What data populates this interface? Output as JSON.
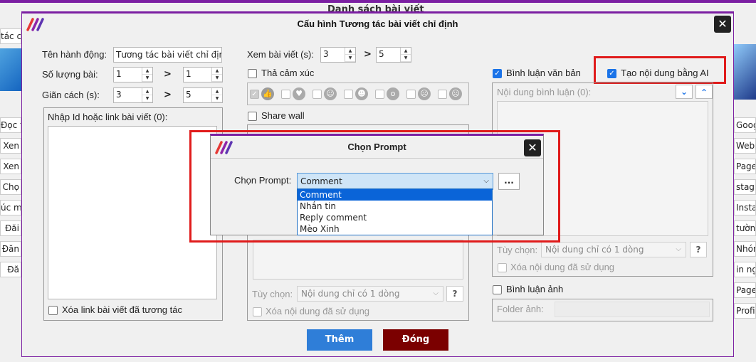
{
  "background": {
    "title": "Danh sách bài viết",
    "left_items": [
      "tác cá",
      "Đọc t",
      "Xen",
      "Xen",
      "Chọ",
      "úc mừ",
      "Đăi",
      "Đăn",
      "Đă"
    ],
    "right_items": [
      "Google",
      "Website",
      "Page",
      "stagram",
      "Instagr",
      "tường",
      "Nhóm",
      "in nghi",
      "Page",
      "Profile"
    ]
  },
  "dialog": {
    "title": "Cấu hình Tương tác bài viết chỉ định",
    "close": "✕",
    "col1": {
      "action_name_label": "Tên hành động:",
      "action_name_value": "Tương tác bài viết chỉ định",
      "post_count_label": "Số lượng bài:",
      "post_count_min": "1",
      "post_count_max": "1",
      "interval_label": "Giãn cách (s):",
      "interval_min": "3",
      "interval_max": "5",
      "gt": ">",
      "link_label": "Nhập Id hoặc link bài viết (0):",
      "delete_link_label": "Xóa link bài viết đã tương tác"
    },
    "col2": {
      "view_label": "Xem bài viết (s):",
      "view_min": "3",
      "view_max": "5",
      "react_label": "Thả cảm xúc",
      "share_label": "Share wall",
      "option_label": "Tùy chọn:",
      "option_value": "Nội dung chỉ có 1 dòng",
      "help": "?",
      "delete_used_label": "Xóa nội dung đã sử dụng"
    },
    "col3": {
      "text_comment_label": "Bình luận văn bản",
      "ai_label": "Tạo nội dung bằng AI",
      "comment_content_label": "Nội dung bình luận (0):",
      "option_label": "Tùy chọn:",
      "option_value": "Nội dung chỉ có 1 dòng",
      "help": "?",
      "delete_used_label": "Xóa nội dung đã sử dụng",
      "image_comment_label": "Bình luận ảnh",
      "folder_label": "Folder ảnh:"
    },
    "add_button": "Thêm",
    "close_button": "Đóng"
  },
  "prompt_dialog": {
    "title": "Chọn Prompt",
    "close": "✕",
    "label": "Chọn Prompt:",
    "selected": "Comment",
    "more": "...",
    "options": [
      "Comment",
      "Nhắn tin",
      "Reply comment",
      "Mèo Xinh"
    ]
  },
  "colors": {
    "accent": "#7b1fa2",
    "primary": "#2f7ed8",
    "danger": "#7b0000",
    "highlight": "#e01b1b"
  }
}
